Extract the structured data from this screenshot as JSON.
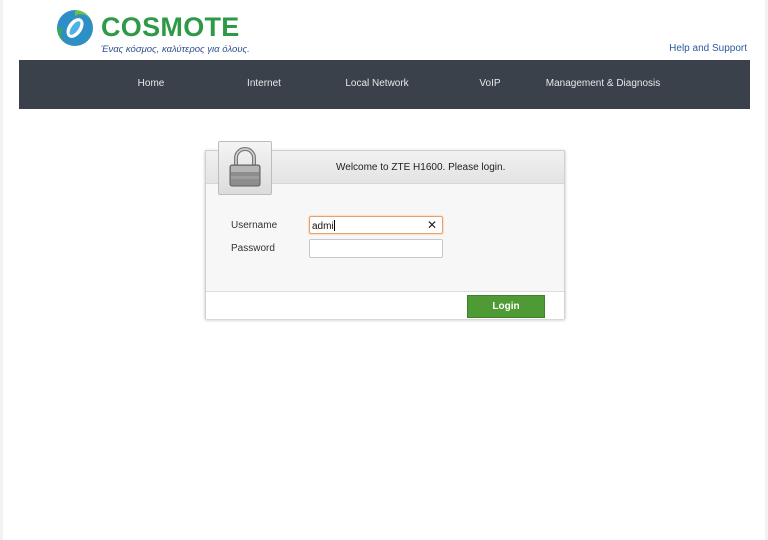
{
  "header": {
    "logo_text": "COSMOTE",
    "tagline": "Ένας κόσμος, καλύτερος για όλους.",
    "help_link": "Help and Support"
  },
  "nav": {
    "items": [
      {
        "label": "Home"
      },
      {
        "label": "Internet"
      },
      {
        "label": "Local Network"
      },
      {
        "label": "VoIP"
      },
      {
        "label": "Management & Diagnosis"
      }
    ]
  },
  "login": {
    "welcome": "Welcome to ZTE H1600. Please login.",
    "username_label": "Username",
    "username_value": "admi",
    "password_label": "Password",
    "password_value": "",
    "login_button": "Login",
    "icon": "lock-icon"
  },
  "colors": {
    "brand_green": "#2e9a48",
    "nav_bg": "#3a414a",
    "login_button": "#4e9a34",
    "focus_border": "#e8a066"
  }
}
